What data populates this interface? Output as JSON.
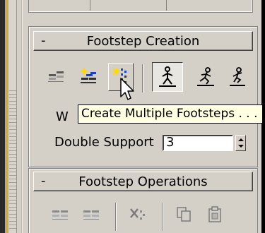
{
  "panel_creation": {
    "title": "Footstep Creation",
    "collapse_symbol": "-",
    "buttons": [
      {
        "name": "create-footsteps-append-icon"
      },
      {
        "name": "create-footsteps-current-icon"
      },
      {
        "name": "create-multiple-footsteps-icon"
      },
      {
        "name": "walk-gait-icon"
      },
      {
        "name": "run-gait-icon"
      },
      {
        "name": "jump-gait-icon"
      }
    ],
    "walk_label_fragment": "W",
    "double_support_label": "Double Support",
    "double_support_value": "3"
  },
  "tooltip": {
    "text": "Create Multiple Footsteps . . ."
  },
  "panel_operations": {
    "title": "Footstep Operations",
    "collapse_symbol": "-"
  },
  "colors": {
    "panel_bg": "#d4d0c8",
    "tooltip_bg": "#ffffe1",
    "accent_blue": "#1a3fc4",
    "accent_yellow": "#ffd800"
  }
}
